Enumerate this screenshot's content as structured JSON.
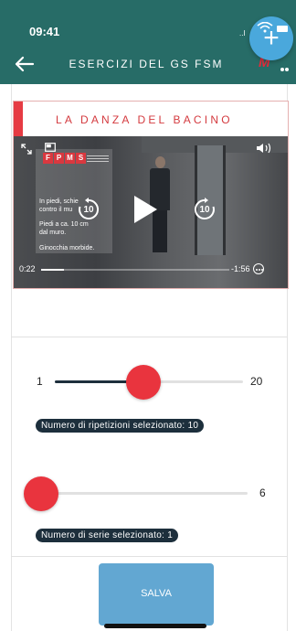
{
  "status_bar": {
    "time": "09:41",
    "signal": "..l"
  },
  "header": {
    "title": "ESERCIZI DEL GS FSM",
    "logo_text": "M"
  },
  "exercise": {
    "title": "LA DANZA DEL BACINO"
  },
  "video": {
    "elapsed": "0:22",
    "remaining": "-1:56",
    "progress_fraction": 0.12,
    "skip_seconds": "10",
    "slide_logo": [
      "F",
      "P",
      "M",
      "S"
    ],
    "slide_lines": [
      "In piedi, schie contro il mu",
      "Piedi a ca. 10 cm dal muro.",
      "Ginocchia morbide."
    ]
  },
  "repetitions": {
    "min": "1",
    "max": "20",
    "selected_fraction": 0.47,
    "label": "Numero di ripetizioni selezionato: 10"
  },
  "series": {
    "max": "6",
    "selected_fraction": 0.0,
    "label": "Numero di serie selezionato: 1"
  },
  "actions": {
    "save_label": "SALVA"
  },
  "colors": {
    "header": "#276c67",
    "accent": "#e9343e",
    "primary": "#62a7d2",
    "dark": "#1d2f3c"
  }
}
